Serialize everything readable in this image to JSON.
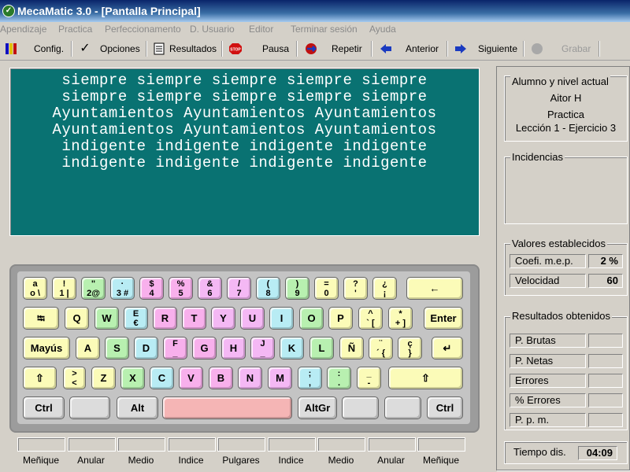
{
  "window": {
    "title": "MecaMatic 3.0  - [Pantalla Principal]"
  },
  "menu": [
    "Apendizaje",
    "Practica",
    "Perfeccionamento",
    "D. Usuario",
    "Editor",
    "Terminar sesión",
    "Ayuda"
  ],
  "toolbar": {
    "config": "Config.",
    "opciones": "Opciones",
    "resultados": "Resultados",
    "pausa": "Pausa",
    "repetir": "Repetir",
    "anterior": "Anterior",
    "siguiente": "Siguiente",
    "grabar": "Grabar"
  },
  "exercise_text": [
    "siempre siempre siempre siempre siempre",
    "siempre siempre siempre siempre siempre",
    "Ayuntamientos Ayuntamientos Ayuntamientos",
    "Ayuntamientos Ayuntamientos Ayuntamientos",
    "indigente indigente indigente indigente",
    "indigente indigente indigente indigente"
  ],
  "keyboard": {
    "colors": {
      "yellow": "#fbfbb8",
      "green": "#b8f0b0",
      "cyan": "#b8ecf4",
      "pink": "#f8b0ec",
      "violet": "#f4b8f4",
      "gray": "#dcdcdc",
      "space": "#f5b5b5"
    },
    "rows": [
      [
        {
          "l": "a\no \\",
          "c": "yellow"
        },
        {
          "l": "!\n1 |",
          "c": "yellow"
        },
        {
          "l": "\"\n2@",
          "c": "green"
        },
        {
          "l": "·\n3 #",
          "c": "cyan"
        },
        {
          "l": "$\n4",
          "c": "pink"
        },
        {
          "l": "%\n5",
          "c": "pink"
        },
        {
          "l": "&\n6",
          "c": "violet"
        },
        {
          "l": "/\n7",
          "c": "violet"
        },
        {
          "l": "(\n8",
          "c": "cyan"
        },
        {
          "l": ")\n9",
          "c": "green"
        },
        {
          "l": "=\n0",
          "c": "yellow"
        },
        {
          "l": "?\n'",
          "c": "yellow"
        },
        {
          "l": "¿\n¡",
          "c": "yellow"
        },
        {
          "l": "←",
          "c": "yellow"
        }
      ],
      [
        {
          "l": "⭾",
          "c": "yellow"
        },
        {
          "l": "Q",
          "c": "yellow"
        },
        {
          "l": "W",
          "c": "green"
        },
        {
          "l": "E\n€",
          "c": "cyan"
        },
        {
          "l": "R",
          "c": "pink"
        },
        {
          "l": "T",
          "c": "pink"
        },
        {
          "l": "Y",
          "c": "violet"
        },
        {
          "l": "U",
          "c": "violet"
        },
        {
          "l": "I",
          "c": "cyan"
        },
        {
          "l": "O",
          "c": "green"
        },
        {
          "l": "P",
          "c": "yellow"
        },
        {
          "l": "^\n` [",
          "c": "yellow"
        },
        {
          "l": "*\n+ ]",
          "c": "yellow"
        },
        {
          "l": "Enter",
          "c": "yellow"
        }
      ],
      [
        {
          "l": "Mayús",
          "c": "yellow"
        },
        {
          "l": "A",
          "c": "yellow"
        },
        {
          "l": "S",
          "c": "green"
        },
        {
          "l": "D",
          "c": "cyan"
        },
        {
          "l": "F\n_",
          "c": "pink"
        },
        {
          "l": "G",
          "c": "pink"
        },
        {
          "l": "H",
          "c": "violet"
        },
        {
          "l": "J\n_",
          "c": "violet"
        },
        {
          "l": "K",
          "c": "cyan"
        },
        {
          "l": "L",
          "c": "green"
        },
        {
          "l": "Ñ",
          "c": "yellow"
        },
        {
          "l": "¨\n´ {",
          "c": "yellow"
        },
        {
          "l": "ç\n}",
          "c": "yellow"
        },
        {
          "l": "↵",
          "c": "yellow"
        }
      ],
      [
        {
          "l": "⇧",
          "c": "yellow"
        },
        {
          "l": ">\n<",
          "c": "yellow"
        },
        {
          "l": "Z",
          "c": "yellow"
        },
        {
          "l": "X",
          "c": "green"
        },
        {
          "l": "C",
          "c": "cyan"
        },
        {
          "l": "V",
          "c": "pink"
        },
        {
          "l": "B",
          "c": "pink"
        },
        {
          "l": "N",
          "c": "violet"
        },
        {
          "l": "M",
          "c": "violet"
        },
        {
          "l": ";\n,",
          "c": "cyan"
        },
        {
          "l": ":\n.",
          "c": "green"
        },
        {
          "l": "_\n-",
          "c": "yellow"
        },
        {
          "l": "⇧",
          "c": "yellow"
        }
      ],
      [
        {
          "l": "Ctrl",
          "c": "gray"
        },
        {
          "l": "",
          "c": "gray"
        },
        {
          "l": "Alt",
          "c": "gray"
        },
        {
          "l": "",
          "c": "space"
        },
        {
          "l": "AltGr",
          "c": "gray"
        },
        {
          "l": "",
          "c": "gray"
        },
        {
          "l": "",
          "c": "gray"
        },
        {
          "l": "Ctrl",
          "c": "gray"
        }
      ]
    ]
  },
  "fingers": [
    "Meñique",
    "Anular",
    "Medio",
    "Indice",
    "Pulgares",
    "Indice",
    "Medio",
    "Anular",
    "Meñique"
  ],
  "student": {
    "title": "Alumno y nivel actual",
    "name": "Aitor H",
    "mode": "Practica",
    "lesson": "Lección 1 - Ejercicio  3"
  },
  "incidencias": {
    "title": "Incidencias"
  },
  "valores": {
    "title": "Valores establecidos",
    "rows": [
      {
        "label": "Coefi. m.e.p.",
        "value": "2 %"
      },
      {
        "label": "Velocidad",
        "value": "60"
      }
    ]
  },
  "resultados": {
    "title": "Resultados obtenidos",
    "rows": [
      {
        "label": "P. Brutas",
        "value": ""
      },
      {
        "label": "P. Netas",
        "value": ""
      },
      {
        "label": "Errores",
        "value": ""
      },
      {
        "label": "%  Errores",
        "value": ""
      },
      {
        "label": "P. p. m.",
        "value": ""
      }
    ]
  },
  "tiempo": {
    "label": "Tiempo dis.",
    "value": "04:09"
  }
}
